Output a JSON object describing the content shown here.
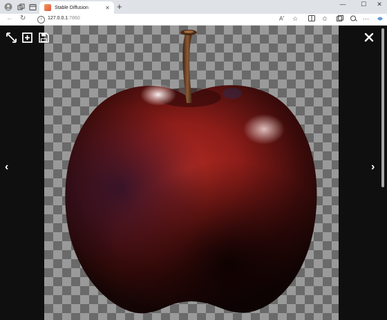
{
  "browser": {
    "tab": {
      "title": "Stable Diffusion",
      "close": "✕"
    },
    "new_tab": "+",
    "window_controls": {
      "minimize": "—",
      "maximize": "☐",
      "close": "✕"
    },
    "address": {
      "host": "127.0.0.1",
      "port": ":7860"
    },
    "icons": [
      "profile-icon",
      "workspaces-icon",
      "tab-actions-icon",
      "back-icon",
      "refresh-icon",
      "site-info-icon",
      "read-aloud-icon",
      "favorite-icon",
      "split-screen-icon",
      "favorites-icon",
      "collections-icon",
      "extensions-icon",
      "more-icon",
      "copilot-icon"
    ]
  },
  "lightbox": {
    "icons": [
      "fullscreen-toggle-icon",
      "zoom-icon",
      "save-icon",
      "close-icon",
      "prev-arrow-icon",
      "next-arrow-icon"
    ],
    "prev": "‹",
    "next": "›",
    "colors": {
      "backdrop": "#151515",
      "checker_light": "#9a9a9a",
      "checker_dark": "#6a6a6a",
      "apple_red": "#8e1d19",
      "stem": "#6b3d22"
    }
  }
}
